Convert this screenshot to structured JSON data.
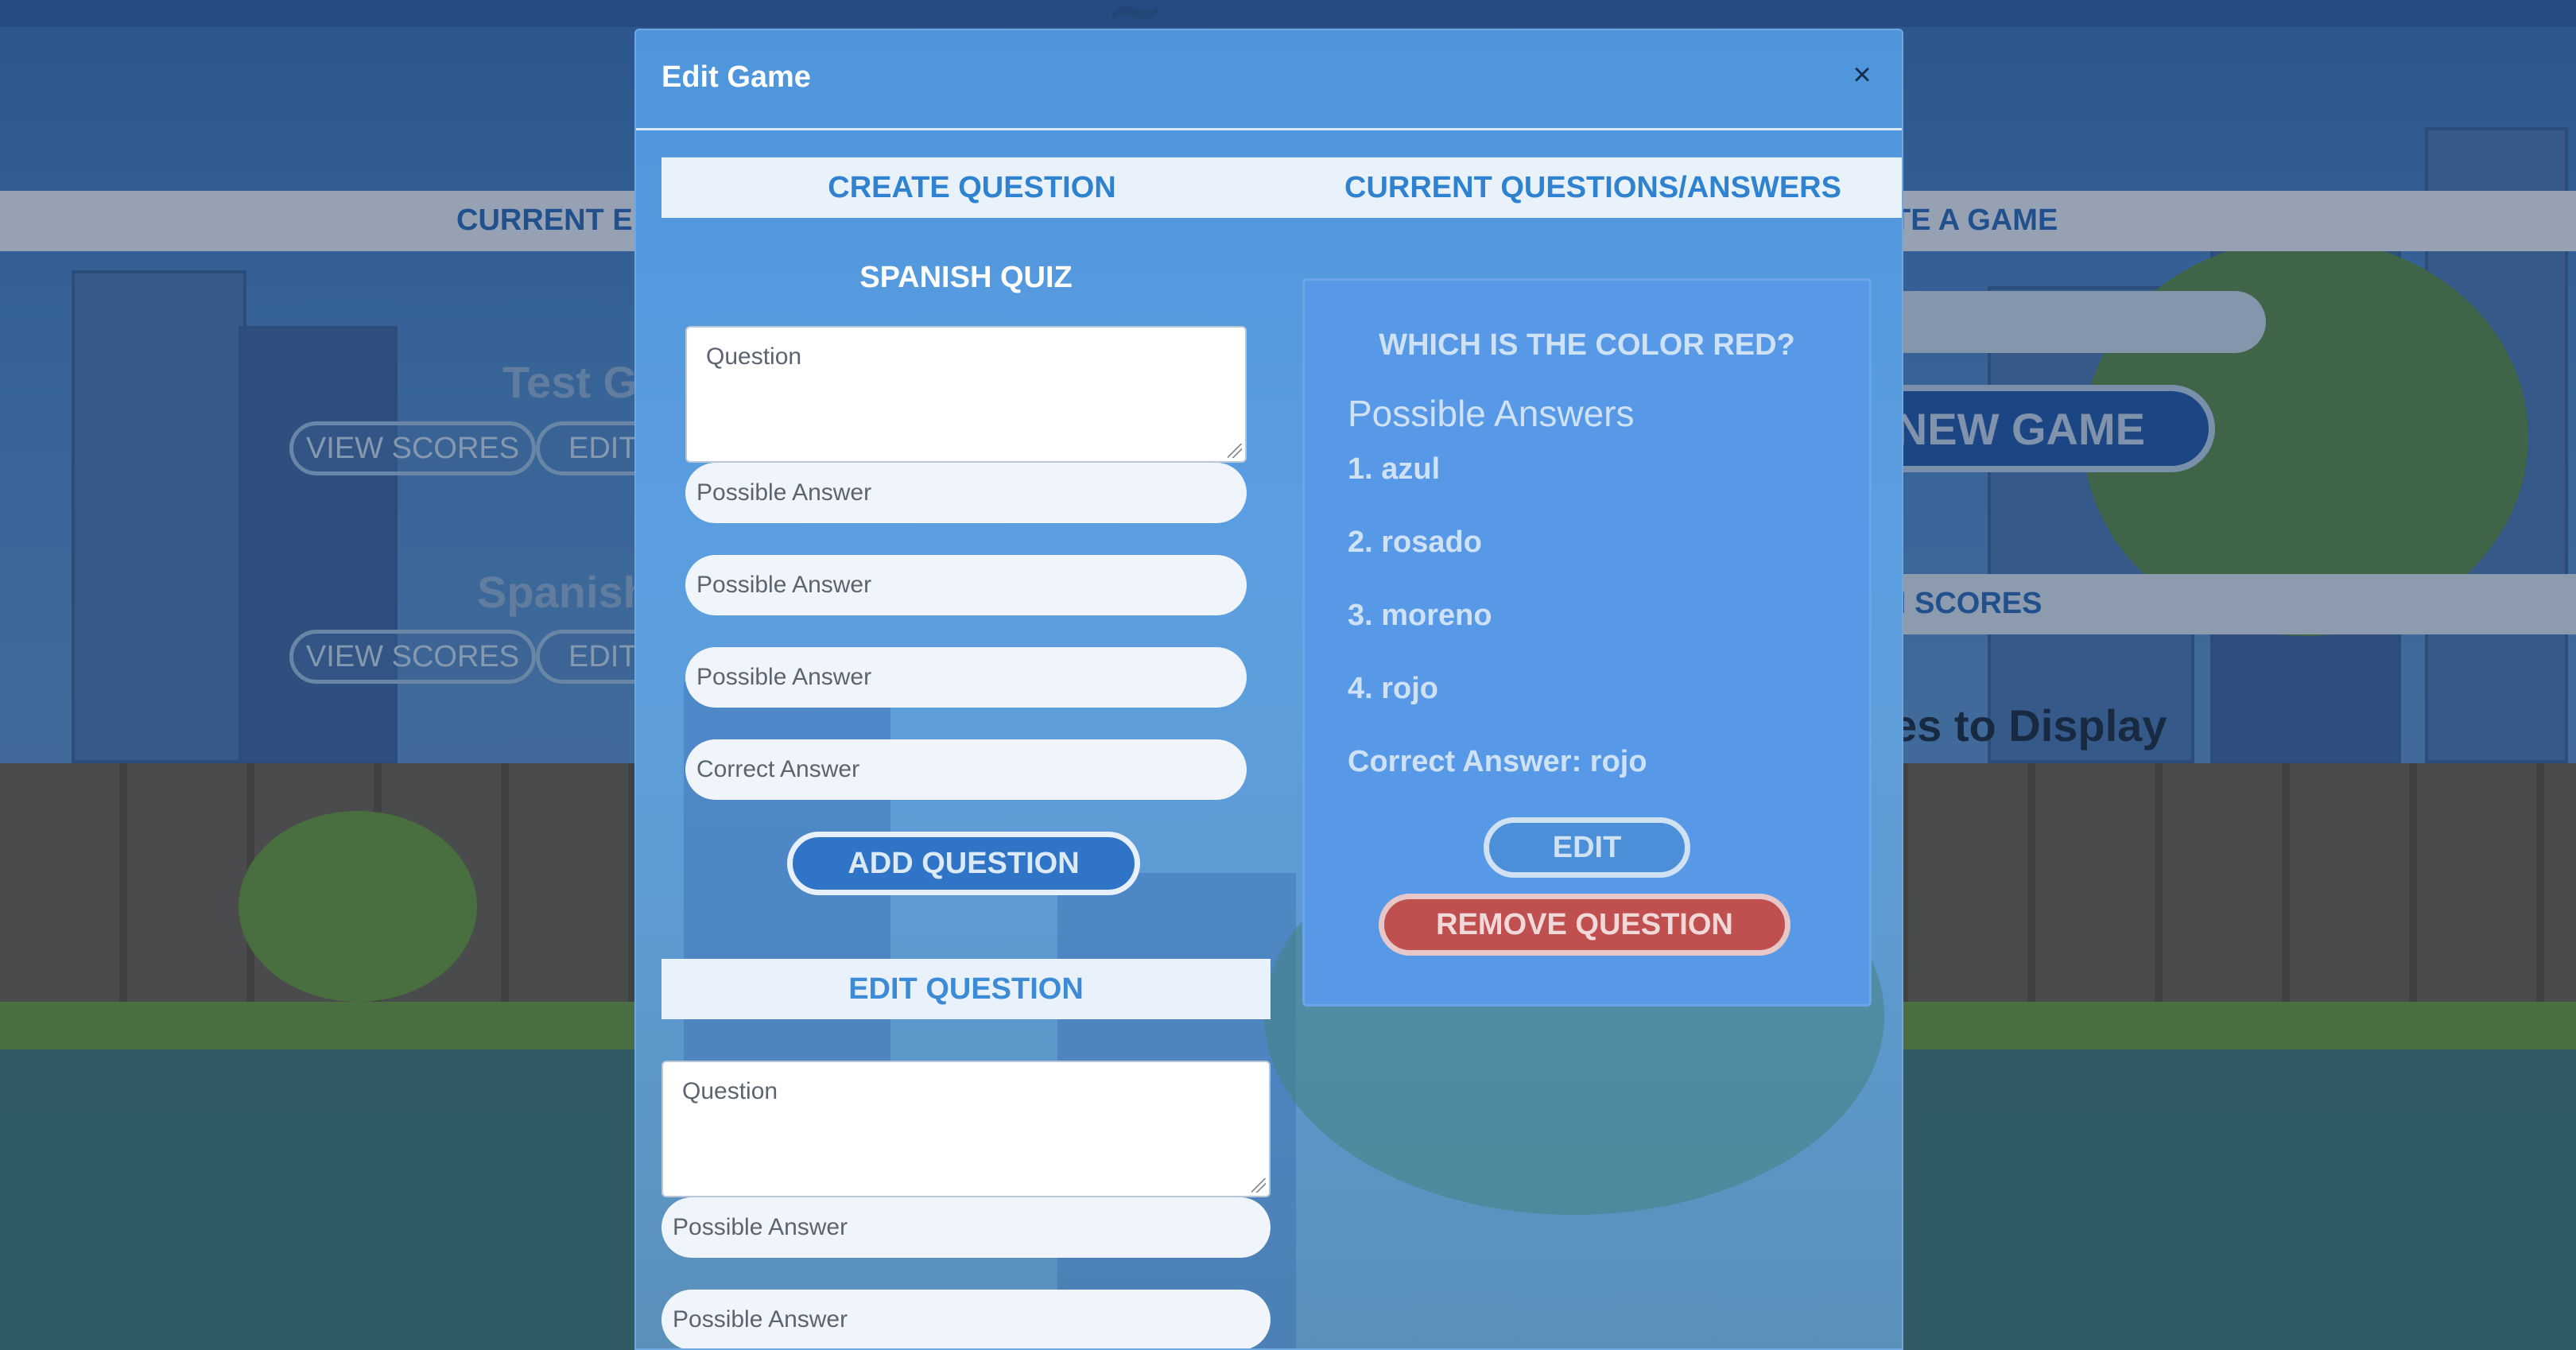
{
  "background": {
    "nav_left": "CURRENT ED",
    "nav_right": "TE A GAME",
    "games": [
      {
        "title": "Test Ga",
        "view_scores": "VIEW SCORES",
        "edit": "EDIT"
      },
      {
        "title": "Spanish",
        "view_scores": "VIEW SCORES",
        "edit": "EDIT"
      }
    ],
    "new_game": "NEW GAME",
    "high_scores": "H SCORES",
    "display_text": "es to Display"
  },
  "modal": {
    "title": "Edit Game",
    "close_symbol": "×",
    "tabs": [
      "CREATE QUESTION",
      "CURRENT QUESTIONS/ANSWERS"
    ],
    "quiz_title": "SPANISH QUIZ",
    "create_form": {
      "question_placeholder": "Question",
      "answer_placeholders": [
        "Possible Answer",
        "Possible Answer",
        "Possible Answer"
      ],
      "correct_placeholder": "Correct Answer",
      "add_button": "ADD QUESTION"
    },
    "edit_section": {
      "title": "EDIT QUESTION",
      "question_placeholder": "Question",
      "answer_placeholders": [
        "Possible Answer",
        "Possible Answer"
      ]
    },
    "current_question": {
      "question": "WHICH IS THE COLOR RED?",
      "possible_label": "Possible Answers",
      "answers": [
        "1. azul",
        "2. rosado",
        "3. moreno",
        "4. rojo"
      ],
      "correct": "Correct Answer: rojo",
      "edit_button": "EDIT",
      "remove_button": "REMOVE QUESTION"
    }
  },
  "colors": {
    "modal_blue": "#5b9ee0",
    "tab_text": "#2f82cf",
    "remove_red": "#c0504f"
  }
}
